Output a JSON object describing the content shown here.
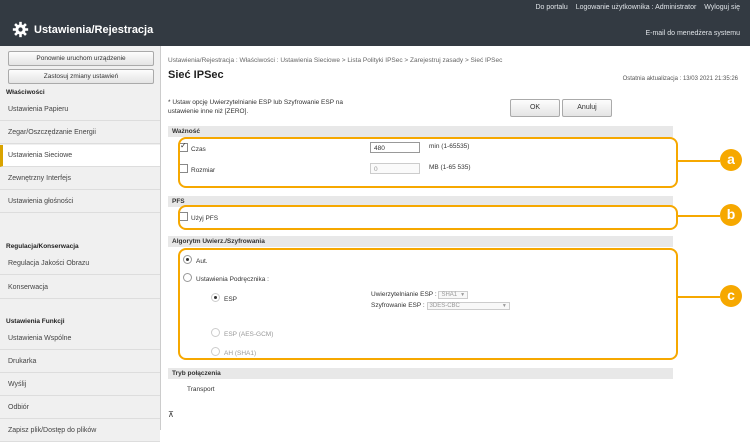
{
  "header": {
    "title": "Ustawienia/Rejestracja",
    "links": [
      "Do portalu",
      "Logowanie użytkownika : Administrator",
      "Wyloguj się"
    ],
    "mail_link": "E-mail do menedżera systemu"
  },
  "sidebar": {
    "buttons": [
      "Ponownie uruchom urządzenie",
      "Zastosuj zmiany ustawień"
    ],
    "section_1": "Właściwości",
    "items_1": [
      "Ustawienia Papieru",
      "Zegar/Oszczędzanie Energii",
      "Ustawienia Sieciowe",
      "Zewnętrzny Interfejs",
      "Ustawienia głośności"
    ],
    "section_2": "Regulacja/Konserwacja",
    "items_2": [
      "Regulacja Jakości Obrazu",
      "Konserwacja"
    ],
    "section_3": "Ustawienia Funkcji",
    "items_3": [
      "Ustawienia Wspólne",
      "Drukarka",
      "Wyślij",
      "Odbiór",
      "Zapisz plik/Dostęp do plików"
    ]
  },
  "main": {
    "breadcrumb": "Ustawienia/Rejestracja : Właściwości : Ustawienia Sieciowe > Lista Polityki IPSec > Zarejestruj zasady > Sieć IPSec",
    "page_title": "Sieć IPSec",
    "last_update": "Ostatnia aktualizacja : 13/03 2021 21:35:26",
    "note": "* Ustaw opcję Uwierzytelnianie ESP lub Szyfrowanie ESP na ustawienie inne niż [ZERO].",
    "ok_label": "OK",
    "cancel_label": "Anuluj",
    "validity": {
      "title": "Ważność",
      "time_label": "Czas",
      "time_value": "480",
      "time_unit": "min (1-65535)",
      "size_label": "Rozmiar",
      "size_value": "0",
      "size_unit": "MB (1-65 535)"
    },
    "pfs": {
      "title": "PFS",
      "use_label": "Użyj PFS"
    },
    "algorithm": {
      "title": "Algorytm Uwierz./Szyfrowania",
      "auto_label": "Aut.",
      "manual_label": "Ustawienia Podręcznika :",
      "esp_label": "ESP",
      "esp_auth_label": "Uwierzytelnianie ESP :",
      "esp_auth_value": "SHA1",
      "esp_enc_label": "Szyfrowanie ESP :",
      "esp_enc_value": "3DES-CBC",
      "esp_gcm_label": "ESP (AES-GCM)",
      "ah_label": "AH (SHA1)"
    },
    "connection": {
      "title": "Tryb połączenia",
      "value": "Transport"
    }
  },
  "badges": {
    "a": "a",
    "b": "b",
    "c": "c"
  },
  "colors": {
    "header_bg": "#333a42",
    "highlight": "#f6a800",
    "active_item_bar": "#d9a300"
  }
}
